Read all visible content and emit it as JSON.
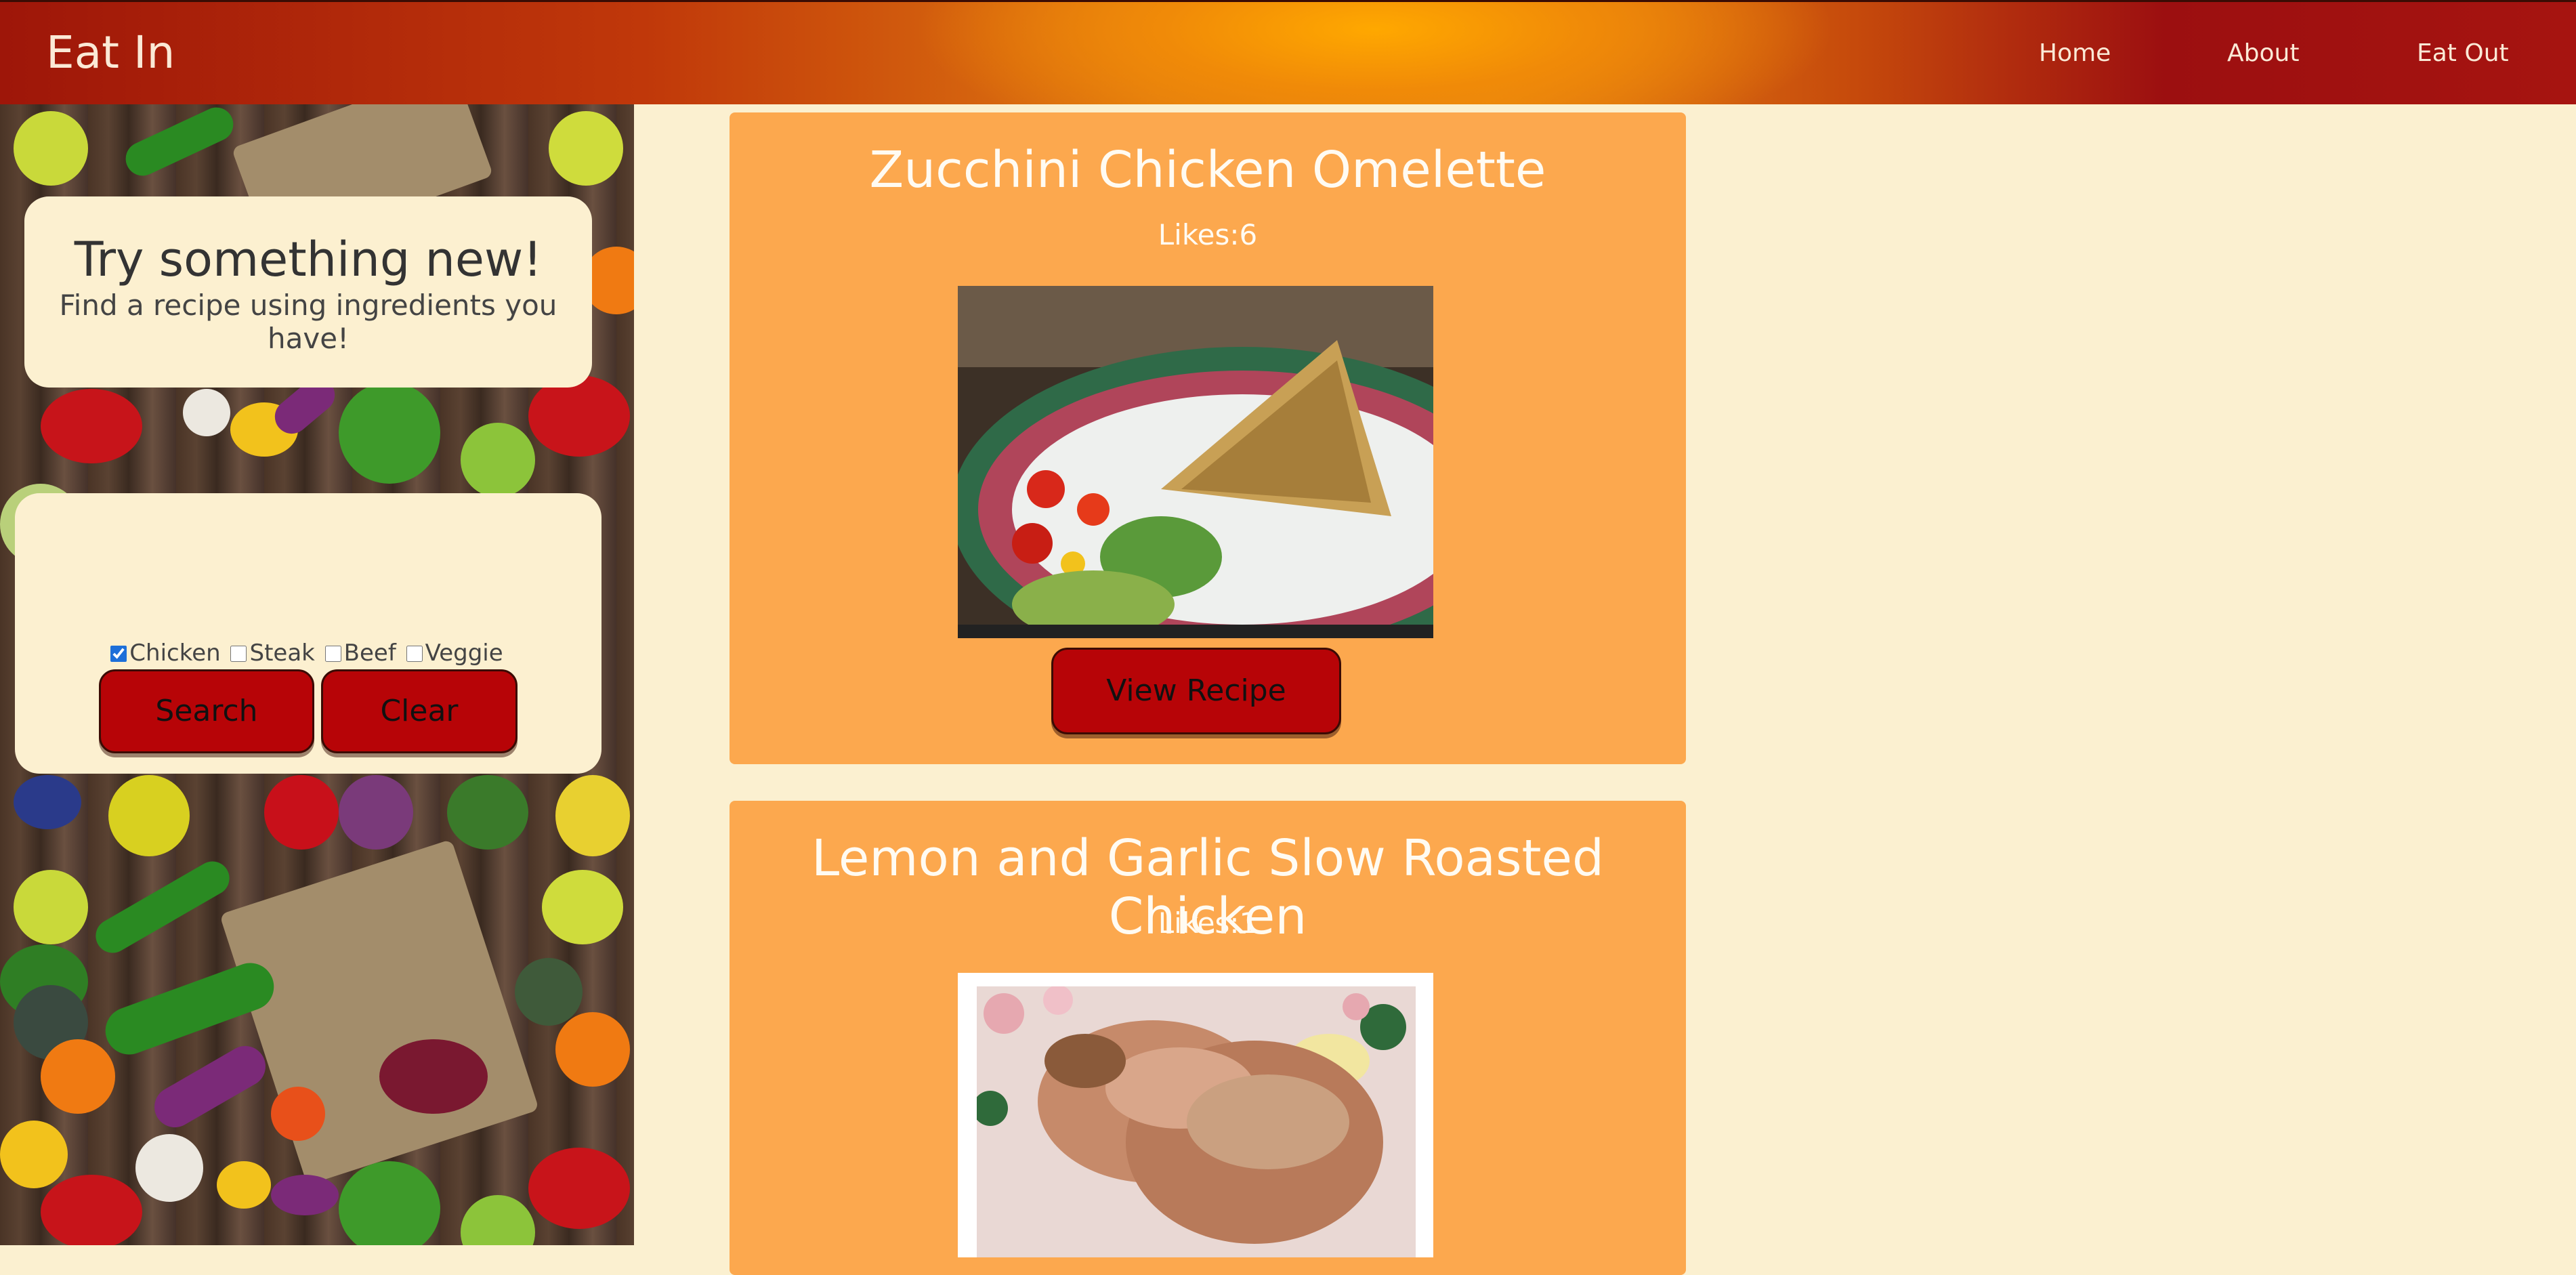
{
  "nav": {
    "brand": "Eat In",
    "links": [
      "Home",
      "About",
      "Eat Out"
    ]
  },
  "hero": {
    "title": "Try something new!",
    "subtitle": "Find a recipe using ingredients you have!"
  },
  "search": {
    "ingredients": [
      {
        "label": "Chicken",
        "checked": true
      },
      {
        "label": "Steak",
        "checked": false
      },
      {
        "label": "Beef",
        "checked": false
      },
      {
        "label": "Veggie",
        "checked": false
      }
    ],
    "search_label": "Search",
    "clear_label": "Clear"
  },
  "recipes": [
    {
      "title": "Zucchini Chicken Omelette",
      "likes": "Likes:6",
      "button_label": "View Recipe"
    },
    {
      "title": "Lemon and Garlic Slow Roasted Chicken",
      "likes": "Likes:1"
    }
  ],
  "colors": {
    "nav_dark": "#9e1609",
    "nav_orange": "#ffa800",
    "page_bg": "#fbf0d0",
    "card_bg": "#fca84e",
    "button": "#b70407"
  }
}
